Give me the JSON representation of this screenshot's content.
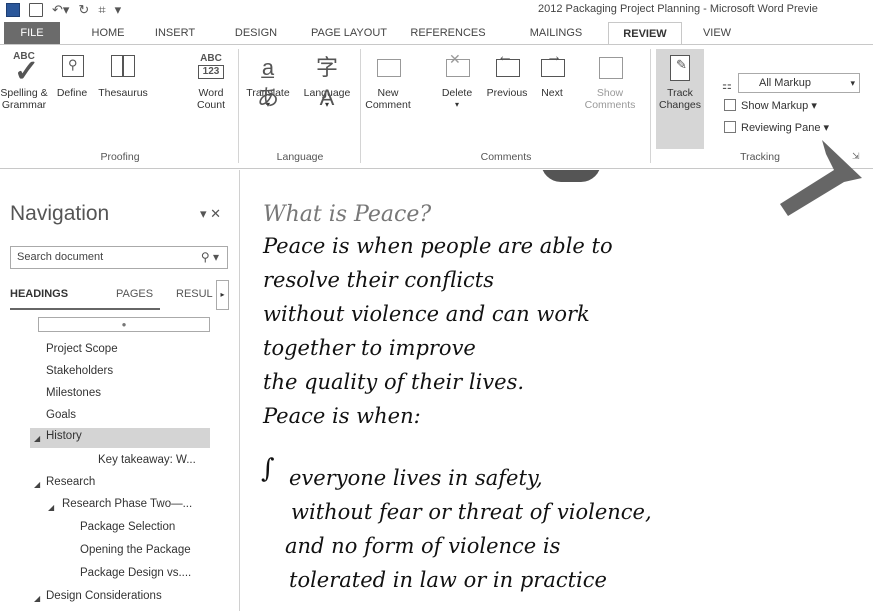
{
  "window": {
    "title": "2012 Packaging Project Planning - Microsoft Word Previe"
  },
  "tabs": [
    {
      "label": "FILE"
    },
    {
      "label": "HOME"
    },
    {
      "label": "INSERT"
    },
    {
      "label": "DESIGN"
    },
    {
      "label": "PAGE LAYOUT"
    },
    {
      "label": "REFERENCES"
    },
    {
      "label": "MAILINGS"
    },
    {
      "label": "REVIEW"
    },
    {
      "label": "VIEW"
    }
  ],
  "ribbon": {
    "proofing": {
      "label": "Proofing",
      "spelling": "Spelling &\nGrammar",
      "spelling_l1": "Spelling &",
      "spelling_l2": "Grammar",
      "define": "Define",
      "thesaurus": "Thesaurus",
      "wordcount_l1": "Word",
      "wordcount_l2": "Count",
      "abc": "ABC",
      "abc123": "123"
    },
    "language": {
      "label": "Language",
      "translate": "Translate",
      "language": "Language"
    },
    "comments": {
      "label": "Comments",
      "new_l1": "New",
      "new_l2": "Comment",
      "delete": "Delete",
      "previous": "Previous",
      "next": "Next",
      "show_l1": "Show",
      "show_l2": "Comments"
    },
    "tracking": {
      "label": "Tracking",
      "track_l1": "Track",
      "track_l2": "Changes",
      "markup_select": "All Markup",
      "show_markup": "Show Markup",
      "reviewing_pane": "Reviewing Pane"
    }
  },
  "navigation": {
    "title": "Navigation",
    "search_placeholder": "Search document",
    "tabs": [
      "HEADINGS",
      "PAGES",
      "RESUL"
    ],
    "items": [
      {
        "label": "Project Scope"
      },
      {
        "label": "Stakeholders"
      },
      {
        "label": "Milestones"
      },
      {
        "label": "Goals"
      },
      {
        "label": "History"
      },
      {
        "label": "Key takeaway: W..."
      },
      {
        "label": "Research"
      },
      {
        "label": "Research Phase Two—..."
      },
      {
        "label": "Package Selection"
      },
      {
        "label": "Opening the Package"
      },
      {
        "label": "Package Design vs...."
      },
      {
        "label": "Design Considerations"
      }
    ]
  },
  "document": {
    "heading": "What is Peace?",
    "lines": [
      "Peace is when people are able to",
      "resolve their conflicts",
      "without violence and can work",
      "together to improve",
      "the quality of their lives.",
      "Peace is when:"
    ],
    "bullet_lines": [
      "everyone lives in safety,",
      "without fear or threat of violence,",
      "and no form of violence is",
      "tolerated in law or in practice"
    ]
  }
}
